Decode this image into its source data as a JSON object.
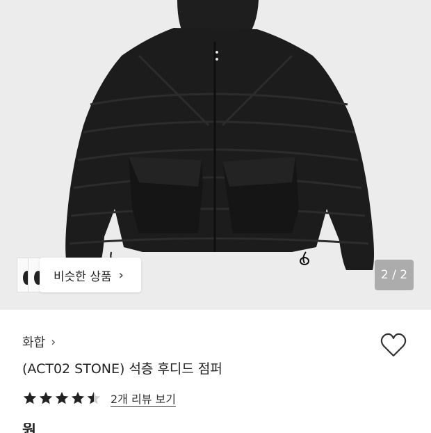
{
  "gallery": {
    "similar_label": "비슷한 상품",
    "counter": "2 / 2",
    "image_subject": "black quilted hooded jacket"
  },
  "product": {
    "brand": "화합",
    "title": "(ACT02 STONE) 석층 후디드 점퍼",
    "rating": 4.5,
    "review_link": "2개 리뷰 보기",
    "price_peek": "원"
  },
  "colors": {
    "hero_bg": "#ececec",
    "jacket": "#1c1c1c",
    "star": "#222222"
  },
  "icons": [
    "chevron-right-icon",
    "heart-icon",
    "star-icon"
  ]
}
